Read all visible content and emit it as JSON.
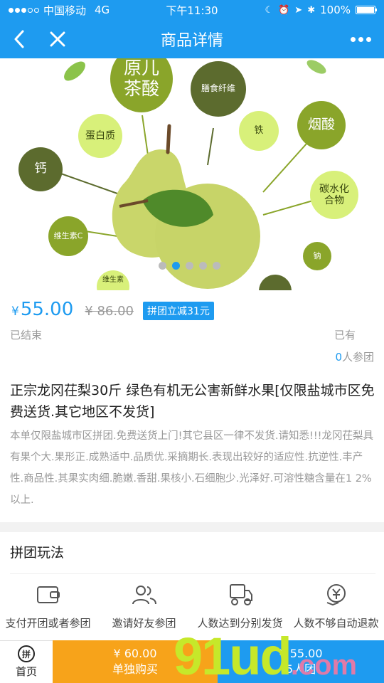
{
  "status_bar": {
    "carrier": "中国移动",
    "network": "4G",
    "time": "下午11:30",
    "battery": "100%",
    "battery_level": 1.0
  },
  "nav": {
    "title": "商品详情"
  },
  "banner": {
    "nutrients": [
      "原儿茶酸",
      "膳食纤维",
      "蛋白质",
      "铁",
      "烟酸",
      "钙",
      "碳水化合物",
      "维生素C",
      "钠",
      "维生素"
    ],
    "slide_count": 5,
    "active_slide": 2
  },
  "product": {
    "currency": "¥",
    "price": "55.00",
    "old_price": "¥ 86.00",
    "badge": "拼团立减31元",
    "ended": "已结束",
    "joined_prefix": "已有",
    "joined_count": "0",
    "joined_suffix": "人参团",
    "title": "正宗龙冈茌梨30斤 绿色有机无公害新鲜水果[仅限盐城市区免费送货.其它地区不发货]",
    "description": "本单仅限盐城市区拼团.免费送货上门!其它县区一律不发货.请知悉!!!龙冈茌梨具有果个大.果形正.成熟适中.品质优.采摘期长.表现出较好的适应性.抗逆性.丰产性.商品性.其果实肉细.脆嫩.香甜.果核小.石细胞少.光泽好.可溶性糖含量在1 2%以上."
  },
  "rules": {
    "title": "拼团玩法",
    "steps": [
      {
        "label": "支付开团或者参团",
        "icon": "wallet-icon"
      },
      {
        "label": "邀请好友参团",
        "icon": "users-icon"
      },
      {
        "label": "人数达到分别发货",
        "icon": "delivery-truck-icon"
      },
      {
        "label": "人数不够自动退款",
        "icon": "refund-icon"
      }
    ]
  },
  "bottom_bar": {
    "home_icon_char": "拼",
    "home_label": "首页",
    "solo_price": "¥ 60.00",
    "solo_label": "单独购买",
    "group_price": "¥ 55.00",
    "group_label": "5人团"
  },
  "watermark": {
    "text": "91ud",
    "suffix": ".com"
  },
  "colors": {
    "accent": "#1e9bf0",
    "solo": "#f7a31a"
  }
}
